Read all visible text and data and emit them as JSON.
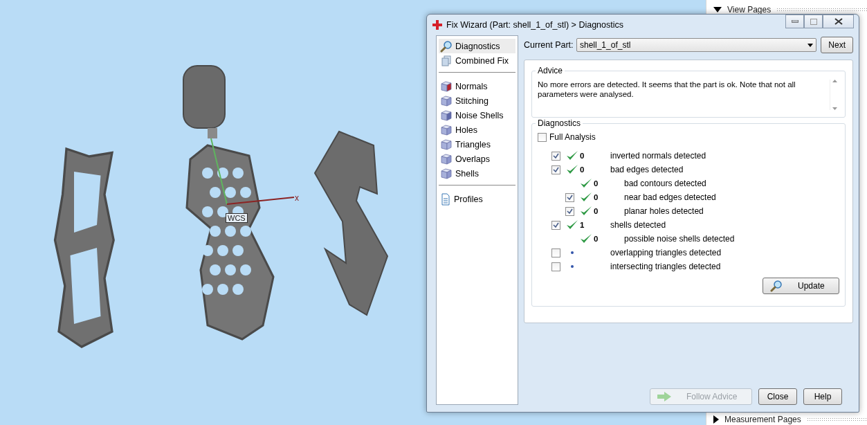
{
  "viewport": {
    "axis_labels": [
      "x",
      "WCS"
    ]
  },
  "side_panel": {
    "sections": [
      "View Pages",
      "Measurement Pages"
    ]
  },
  "dialog": {
    "title": "Fix Wizard (Part: shell_1_of_stl) > Diagnostics",
    "nav_groups": [
      [
        {
          "label": "Diagnostics",
          "selected": true
        },
        {
          "label": "Combined Fix",
          "selected": false
        }
      ],
      [
        {
          "label": "Normals",
          "selected": false
        },
        {
          "label": "Stitching",
          "selected": false
        },
        {
          "label": "Noise Shells",
          "selected": false
        },
        {
          "label": "Holes",
          "selected": false
        },
        {
          "label": "Triangles",
          "selected": false
        },
        {
          "label": "Overlaps",
          "selected": false
        },
        {
          "label": "Shells",
          "selected": false
        }
      ],
      [
        {
          "label": "Profiles",
          "selected": false
        }
      ]
    ],
    "current_part": {
      "label": "Current Part:",
      "value": "shell_1_of_stl"
    },
    "next_button": "Next",
    "advice": {
      "title": "Advice",
      "text": "No more errors are detected. It seems that the part is ok. Note that not all parameters were analysed."
    },
    "diagnostics": {
      "title": "Diagnostics",
      "full_analysis": {
        "label": "Full Analysis",
        "checked": false
      },
      "rows": [
        {
          "kind": "checkbox",
          "checked": true,
          "passed": true,
          "count": "0",
          "label": "inverted normals detected"
        },
        {
          "kind": "checkbox",
          "checked": true,
          "passed": true,
          "count": "0",
          "label": "bad edges detected",
          "children": [
            {
              "kind": "plain",
              "passed": true,
              "count": "0",
              "label": "bad contours detected"
            },
            {
              "kind": "checkbox",
              "checked": true,
              "passed": true,
              "count": "0",
              "label": "near bad edges detected"
            },
            {
              "kind": "checkbox",
              "checked": true,
              "passed": true,
              "count": "0",
              "label": "planar holes detected"
            }
          ]
        },
        {
          "kind": "checkbox",
          "checked": true,
          "passed": true,
          "count": "1",
          "label": "shells detected",
          "children": [
            {
              "kind": "plain",
              "passed": true,
              "count": "0",
              "label": "possible noise shells detected"
            }
          ]
        },
        {
          "kind": "checkbox",
          "checked": false,
          "passed": false,
          "label": "overlapping triangles detected"
        },
        {
          "kind": "checkbox",
          "checked": false,
          "passed": false,
          "label": "intersecting triangles detected"
        }
      ]
    },
    "update_button": "Update",
    "buttons": [
      {
        "kind": "advice",
        "label": "Follow Advice",
        "disabled": true
      },
      {
        "kind": "plain",
        "label": "Close",
        "disabled": false
      },
      {
        "kind": "plain",
        "label": "Help",
        "disabled": false
      }
    ]
  }
}
